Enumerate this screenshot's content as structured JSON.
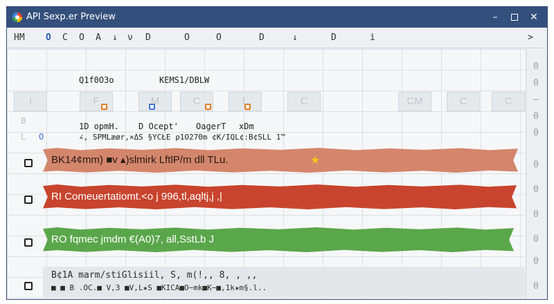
{
  "window": {
    "title": "API Sexp.er Preview"
  },
  "toolbar": {
    "items": [
      "HM",
      "O",
      "C",
      "O",
      "A",
      "↓",
      "ν",
      "D",
      "O",
      "O",
      "D",
      "↓",
      "D",
      "i",
      "",
      ">"
    ]
  },
  "header": {
    "col1_title": "Q1f0O3o",
    "col2_title": "KEMS1/DBLW",
    "sub_labels": [
      "1D opmH.",
      "D Ocept'",
      "OagerT",
      "xDm"
    ],
    "sub_values": "∠, SPMLæør,×ΔS §YCŁE ρ1O270m ¢K/IQL¢:B¢SLL 1™",
    "left_markers": [
      "0",
      "L",
      "O"
    ],
    "ghost_cells": [
      "I",
      "F",
      "M",
      "C",
      "L",
      "C",
      "CM",
      "C",
      "C"
    ]
  },
  "rows": [
    {
      "text": "BK14¢mm) ■v ▴)slmirk LftlP/m dll TLu.",
      "star": "★"
    },
    {
      "text": "RI Comeuertatiomt.<o j  996,tl,aqltj,j    ,|",
      "marker": "1"
    },
    {
      "text": "RO fqmec jmdm €(A0)7,   all,SstLb     J"
    },
    {
      "text_line1": "B¢1A marm/stiGlisiil,  S,      m(!,,   8,  ,  ,,",
      "text_line2": "■ ■ B  .OC.■ V,3 ■V,L★S ■KICA■O−mk■K−■,1k★m§.l.."
    }
  ],
  "scrollbar": {
    "items": [
      "0",
      "0",
      "−",
      "0",
      "0",
      "0",
      "0",
      "0",
      "0",
      "0",
      "0"
    ]
  },
  "colors": {
    "titlebar": "#33507c",
    "row_orange": "#d4866c",
    "row_red": "#c8442e",
    "row_green": "#5aa74b",
    "marker_orange": "#e47a1a",
    "marker_blue": "#3a6fd8"
  }
}
